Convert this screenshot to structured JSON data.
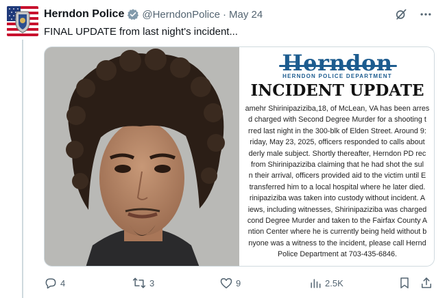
{
  "tweet": {
    "display_name": "Herndon Police",
    "handle": "@HerndonPolice",
    "separator": "·",
    "time": "May 24",
    "text": "FINAL UPDATE from last night's incident..."
  },
  "media": {
    "card": {
      "logo": "Herndon",
      "department": "HERNDON POLICE DEPARTMENT",
      "title": "INCIDENT UPDATE",
      "lines": [
        "amehr Shirinipaziziba,18, of McLean, VA has been arres",
        "d charged with Second Degree Murder for a shooting t",
        "rred last night in the 300-blk of Elden Street. Around 9:",
        "riday, May 23, 2025, officers responded to calls about",
        "derly male subject. Shortly thereafter, Herndon PD rec",
        "from Shirinipaziziba claiming that he had shot the sul",
        "n their arrival, officers provided aid to the victim until E",
        "transferred him to a local hospital where he later died.",
        "rinipaziziba was taken into custody without incident. A",
        "iews, including witnesses, Shirinipaziziba was charged",
        "cond Degree Murder and taken to the Fairfax County A",
        "ntion Center where he is currently being held without b",
        "nyone was a witness to the incident, please call Hernd",
        "Police Department at 703-435-6846."
      ]
    }
  },
  "actions": {
    "replies": "4",
    "reposts": "3",
    "likes": "9",
    "views": "2.5K"
  },
  "icons": {
    "verified": "verified-badge-icon",
    "grok": "grok-icon",
    "more": "more-icon",
    "reply": "reply-icon",
    "repost": "repost-icon",
    "like": "like-icon",
    "views": "views-icon",
    "bookmark": "bookmark-icon",
    "share": "share-icon"
  },
  "colors": {
    "secondary_text": "#536471",
    "brand_blue": "#1d5c8f",
    "verified": "#829aab"
  }
}
